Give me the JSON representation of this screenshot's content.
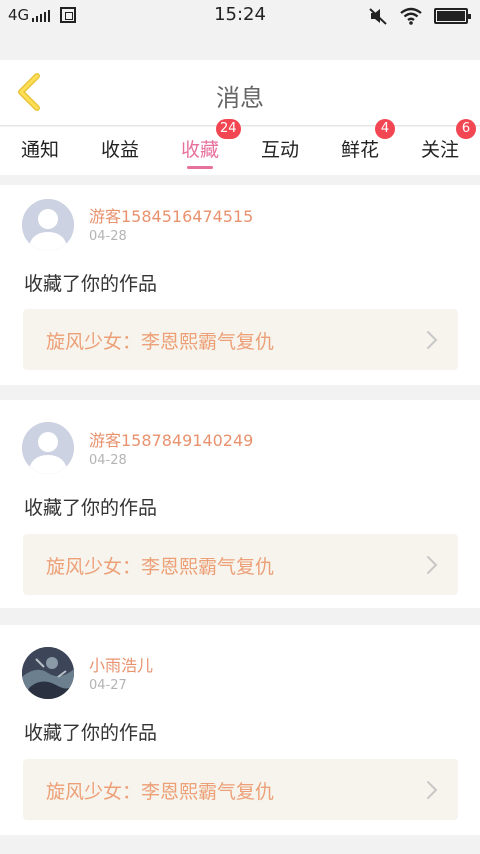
{
  "status_bar": {
    "network": "4G",
    "time": "15:24"
  },
  "header": {
    "title": "消息"
  },
  "tabs": [
    {
      "label": "通知",
      "badge": ""
    },
    {
      "label": "收益",
      "badge": ""
    },
    {
      "label": "收藏",
      "badge": "24",
      "active": true
    },
    {
      "label": "互动",
      "badge": ""
    },
    {
      "label": "鲜花",
      "badge": "4"
    },
    {
      "label": "关注",
      "badge": "6"
    }
  ],
  "messages": [
    {
      "username": "游客1584516474515",
      "date": "04-28",
      "action": "收藏了你的作品",
      "work_title": "旋风少女：李恩熙霸气复仇"
    },
    {
      "username": "游客1587849140249",
      "date": "04-28",
      "action": "收藏了你的作品",
      "work_title": "旋风少女：李恩熙霸气复仇"
    },
    {
      "username": "小雨浩儿",
      "date": "04-27",
      "action": "收藏了你的作品",
      "work_title": "旋风少女：李恩熙霸气复仇"
    }
  ],
  "colors": {
    "accent": "#e7719d",
    "badge": "#f24753",
    "username": "#e8926e",
    "work_title": "#eda078",
    "work_box_bg": "#f6f4ec"
  },
  "icons": [
    "back-chevron-icon",
    "chevron-right-icon",
    "default-avatar-icon",
    "wifi-icon",
    "mute-icon",
    "battery-icon"
  ]
}
